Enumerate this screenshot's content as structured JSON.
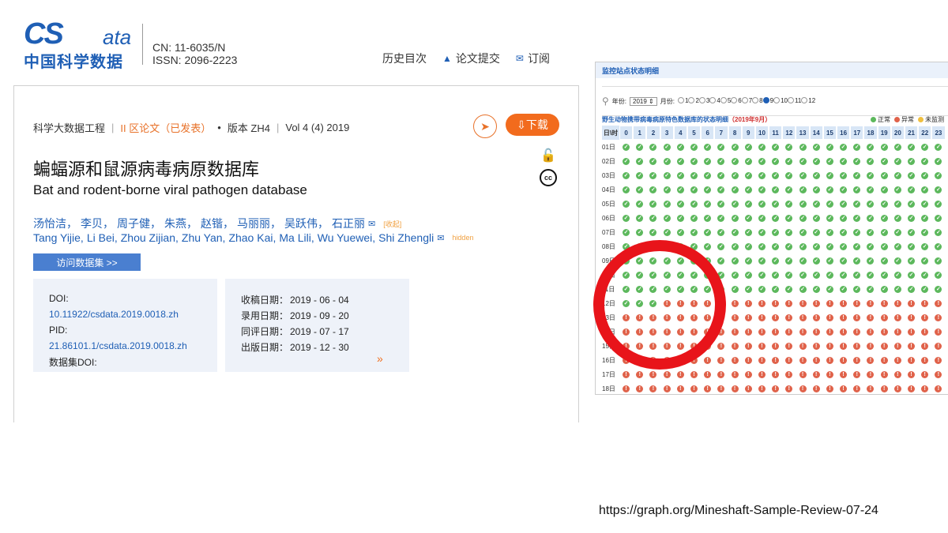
{
  "logo": {
    "big": "CS",
    "suffix": "ata",
    "cn": "中国科学数据"
  },
  "journal": {
    "cn": "CN: 11-6035/N",
    "issn": "ISSN: 2096-2223"
  },
  "nav": {
    "history": "历史目次",
    "submit": "论文提交",
    "subscribe": "订阅"
  },
  "meta": {
    "field": "科学大数据工程",
    "section": "II 区论文（已发表）",
    "version": "版本 ZH4",
    "volume": "Vol 4 (4) 2019"
  },
  "actions": {
    "download": "下载"
  },
  "title_cn": "蝙蝠源和鼠源病毒病原数据库",
  "title_en": "Bat and rodent-borne viral pathogen database",
  "authors_cn": [
    "汤怡洁，",
    "李贝，",
    "周子健，",
    "朱燕，",
    "赵锴，",
    "马丽丽，",
    "吴跃伟，",
    "石正丽"
  ],
  "authors_cn_note": "[收起]",
  "authors_en": [
    "Tang Yijie,",
    "Li Bei,",
    "Zhou Zijian,",
    "Zhu Yan,",
    "Zhao Kai,",
    "Ma Lili,",
    "Wu Yuewei,",
    "Shi Zhengli"
  ],
  "authors_en_note": "hidden",
  "visit_button": "访问数据集 >>",
  "ids": {
    "doi_label": "DOI:",
    "doi": "10.11922/csdata.2019.0018.zh",
    "pid_label": "PID:",
    "pid": "21.86101.1/csdata.2019.0018.zh",
    "dataset_doi_label": "数据集DOI:"
  },
  "dates": {
    "received_label": "收稿日期：",
    "received": "2019 - 06 - 04",
    "accepted_label": "录用日期：",
    "accepted": "2019 - 09 - 20",
    "reviewed_label": "同评日期：",
    "reviewed": "2019 - 07 - 17",
    "published_label": "出版日期：",
    "published": "2019 - 12 - 30"
  },
  "monitor": {
    "header": "监控站点状态明细",
    "year_label": "年份:",
    "year": "2019",
    "month_label": "月份:",
    "months": [
      "1",
      "2",
      "3",
      "4",
      "5",
      "6",
      "7",
      "8",
      "9",
      "10",
      "11",
      "12"
    ],
    "selected_month": "9",
    "table_title": "野生动物携带病毒病原特色数据库的状态明细",
    "table_title_date": "（2019年9月）",
    "legend": {
      "ok": "正常",
      "bad": "异常",
      "none": "未监测"
    },
    "corner_label": "日\\时",
    "hours": [
      "0",
      "1",
      "2",
      "3",
      "4",
      "5",
      "6",
      "7",
      "8",
      "9",
      "10",
      "11",
      "12",
      "13",
      "14",
      "15",
      "16",
      "17",
      "18",
      "19",
      "20",
      "21",
      "22",
      "23"
    ],
    "days": [
      "01日",
      "02日",
      "03日",
      "04日",
      "05日",
      "06日",
      "07日",
      "08日",
      "09日",
      "10日",
      "11日",
      "12日",
      "13日",
      "14日",
      "15日",
      "16日",
      "17日",
      "18日"
    ],
    "ok_until_day": 12,
    "ok_until_hour": 2,
    "ok_mark": "✓",
    "bad_mark": "!"
  },
  "footer_url": "https://graph.org/Mineshaft-Sample-Review-07-24",
  "colors": {
    "brand": "#1f5fb5",
    "accent": "#f26b1d",
    "ring": "#e8141a",
    "ok": "#5cb85c",
    "bad": "#e0624a"
  }
}
